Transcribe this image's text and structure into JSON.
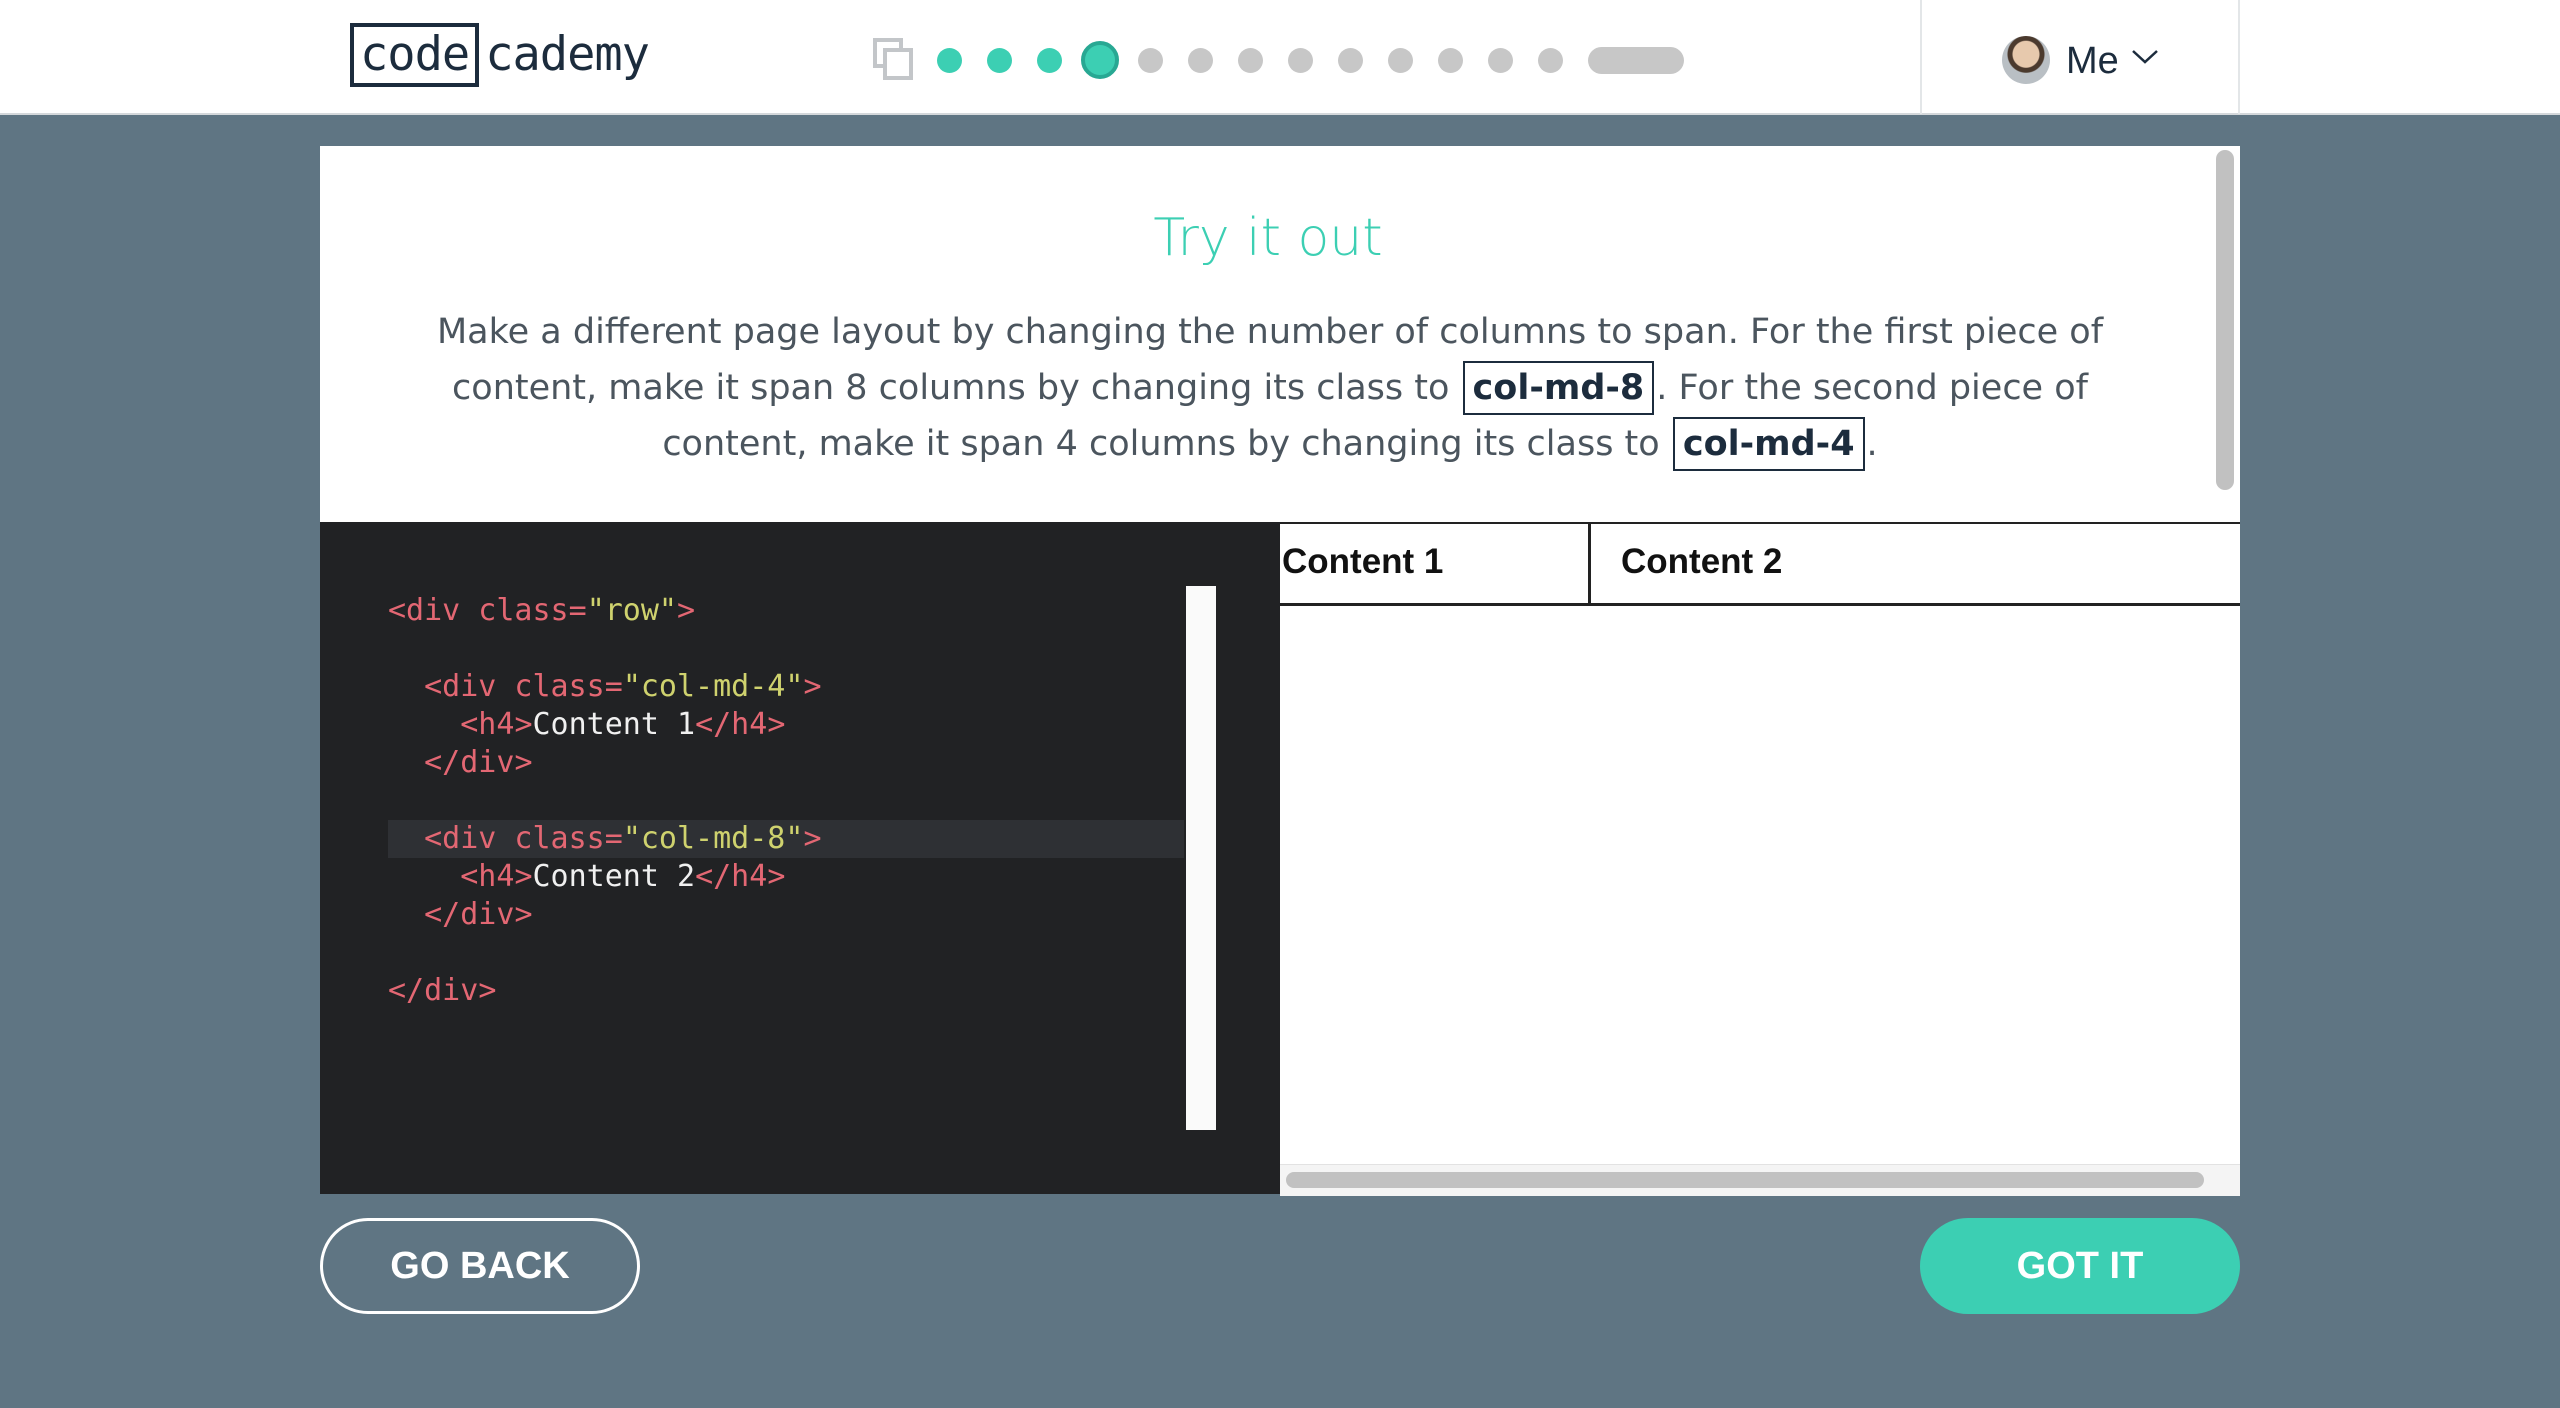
{
  "header": {
    "logo_boxed": "code",
    "logo_rest": "cademy",
    "user_label": "Me",
    "progress": {
      "total_steps": 13,
      "completed_steps": 3,
      "current_step": 4
    },
    "icons": [
      "copy-icon",
      "avatar",
      "chevron-down-icon"
    ]
  },
  "lesson": {
    "title": "Try it out",
    "instructions": {
      "part1": "Make a different page layout by changing the number of columns to span. For the first piece of content, make it span 8 columns by changing its class to ",
      "code1": "col-md-8",
      "part2": ". For the second piece of content, make it span 4 columns by changing its class to ",
      "code2": "col-md-4",
      "part3": "."
    }
  },
  "editor": {
    "lines": [
      "<div class=\"row\">",
      "",
      "  <div class=\"col-md-4\">",
      "    <h4>Content 1</h4>",
      "  </div>",
      "",
      "  <div class=\"col-md-8\">",
      "    <h4>Content 2</h4>",
      "  </div>",
      "",
      "</div>"
    ],
    "highlighted_line": 7
  },
  "preview": {
    "col1": "Content 1",
    "col2": "Content 2"
  },
  "buttons": {
    "back": "GO BACK",
    "got_it": "GOT IT"
  },
  "colors": {
    "background": "#5f7583",
    "accent": "#3ccfb3",
    "navy": "#1c2c3d",
    "editor_bg": "#212224",
    "tag": "#e36773",
    "string": "#cfd26e"
  }
}
